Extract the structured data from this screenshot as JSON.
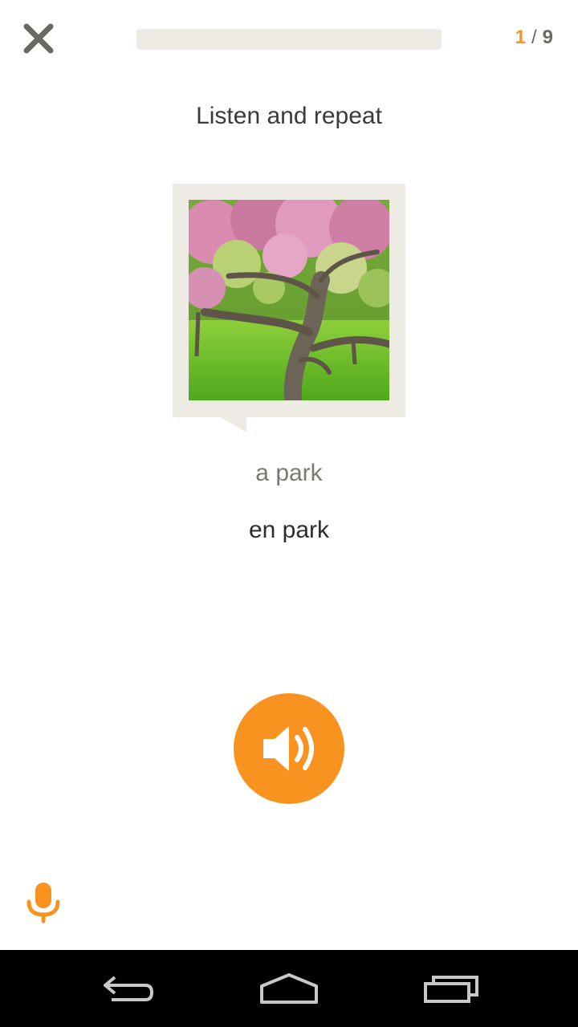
{
  "header": {
    "close_icon": "close-x-icon",
    "progress": {
      "current": "1",
      "total": "9",
      "separator": "/",
      "fill_fraction": 0
    }
  },
  "lesson": {
    "prompt": "Listen and repeat",
    "translation": "a park",
    "target_word": "en park",
    "speaker_icon": "speaker-icon",
    "mic_icon": "microphone-icon"
  },
  "navbar": {
    "back_icon": "back-arrow-icon",
    "home_icon": "home-icon",
    "recents_icon": "recent-apps-icon"
  },
  "colors": {
    "accent": "#f7931e",
    "card_bg": "#eeebe4",
    "icon_gray": "#6b6a62"
  }
}
